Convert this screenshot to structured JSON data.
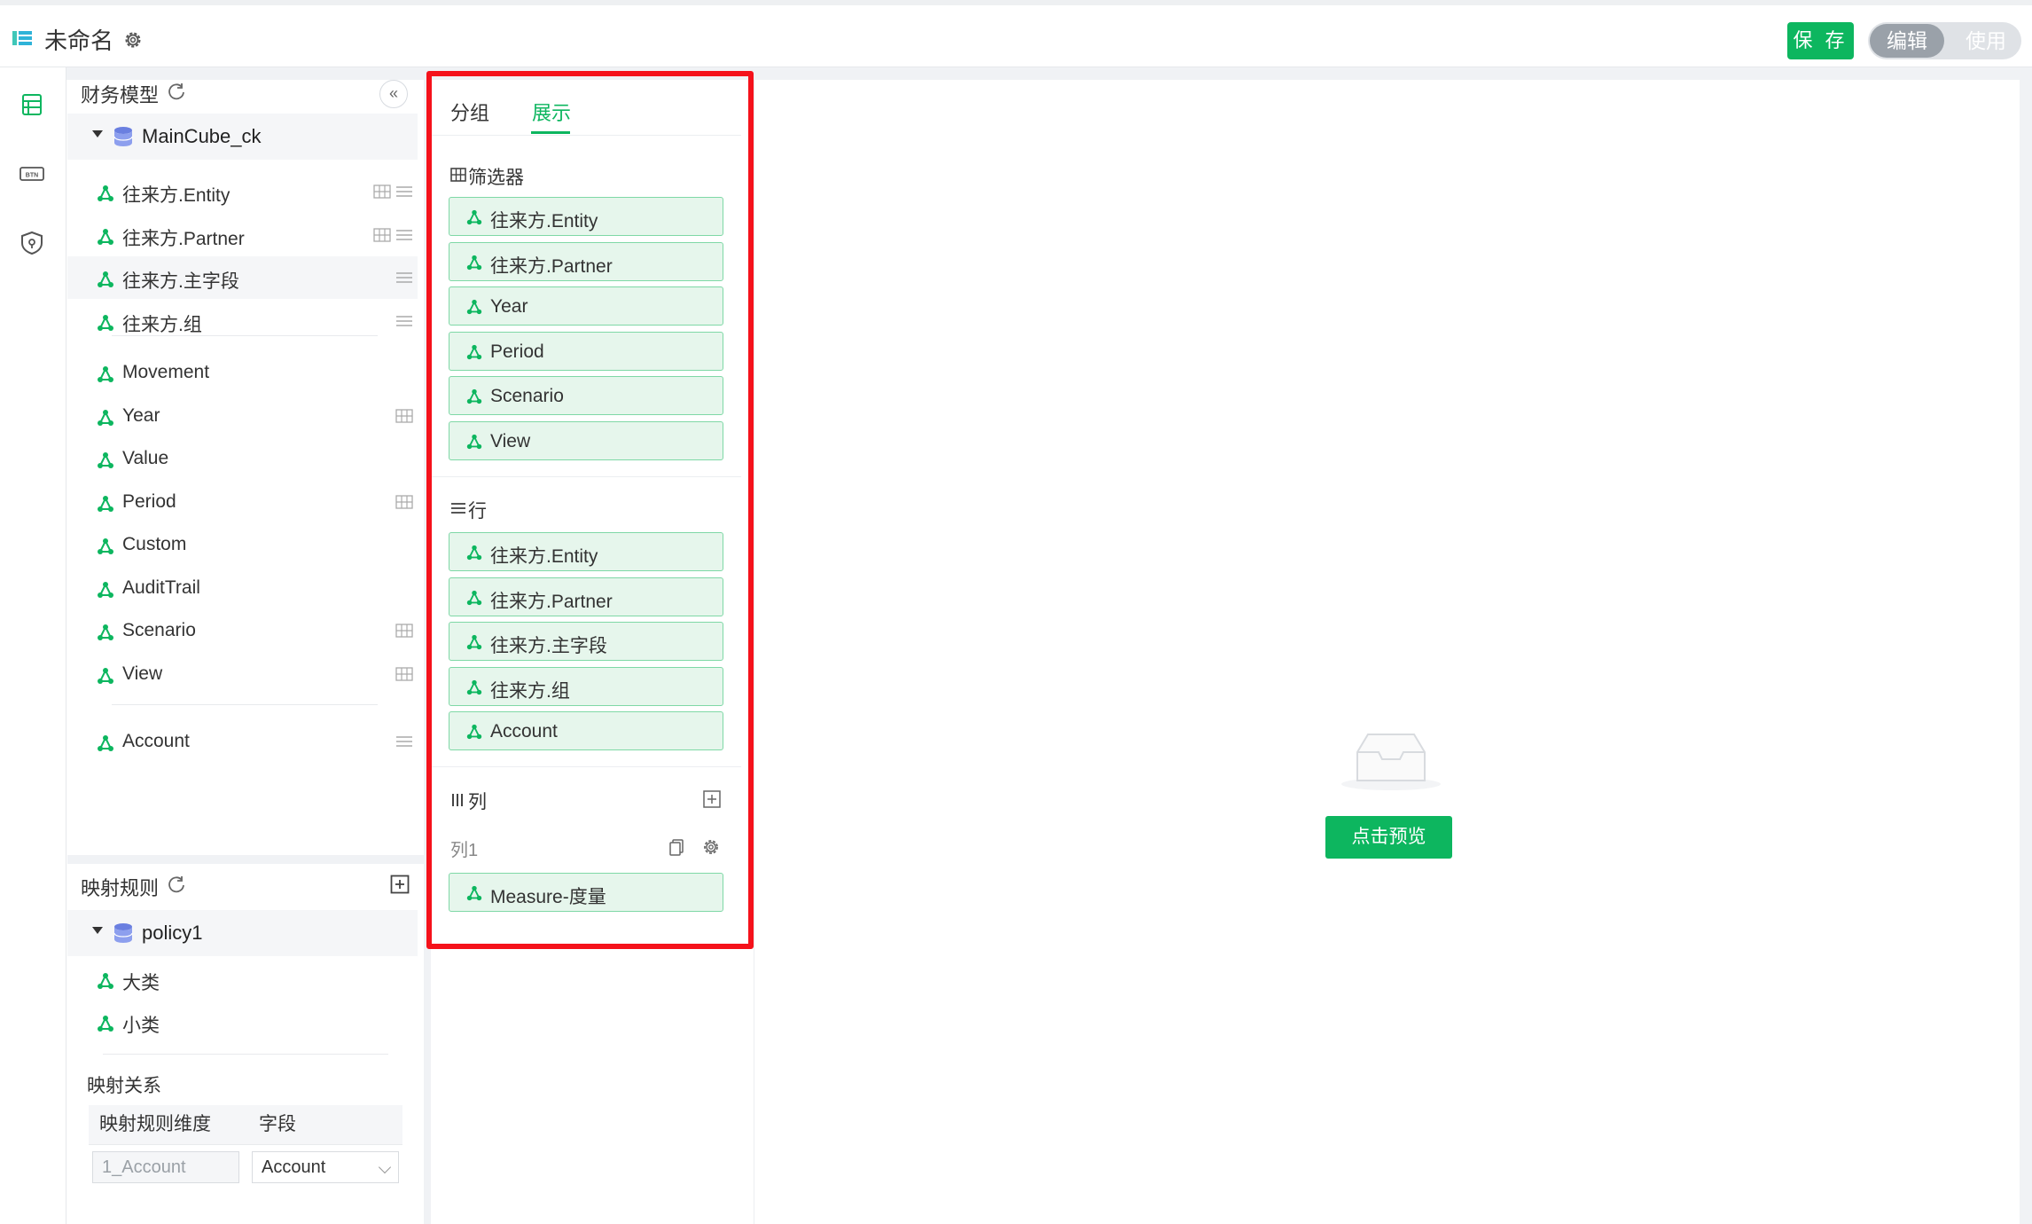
{
  "app": {
    "title": "未命名"
  },
  "header": {
    "save_label": "保 存",
    "mode_edit": "编辑",
    "mode_use": "使用"
  },
  "rail": [
    "table-icon",
    "btn-icon",
    "shield-icon"
  ],
  "model": {
    "title": "财务模型",
    "cube": "MainCube_ck",
    "group1": [
      {
        "label": "往来方.Entity",
        "icons": [
          "grid",
          "list"
        ]
      },
      {
        "label": "往来方.Partner",
        "icons": [
          "grid",
          "list"
        ]
      },
      {
        "label": "往来方.主字段",
        "icons": [
          "list"
        ]
      },
      {
        "label": "往来方.组",
        "icons": [
          "list"
        ]
      }
    ],
    "group2": [
      {
        "label": "Movement",
        "icons": []
      },
      {
        "label": "Year",
        "icons": [
          "grid"
        ]
      },
      {
        "label": "Value",
        "icons": []
      },
      {
        "label": "Period",
        "icons": [
          "grid"
        ]
      },
      {
        "label": "Custom",
        "icons": []
      },
      {
        "label": "AuditTrail",
        "icons": []
      },
      {
        "label": "Scenario",
        "icons": [
          "grid"
        ]
      },
      {
        "label": "View",
        "icons": [
          "grid"
        ]
      }
    ],
    "group3": [
      {
        "label": "Account",
        "icons": [
          "list"
        ]
      }
    ]
  },
  "mapping": {
    "title": "映射规则",
    "policy": "policy1",
    "items": [
      "大类",
      "小类"
    ],
    "relation_title": "映射关系",
    "col_dim": "映射规则维度",
    "col_field": "字段",
    "row_dim": "1_Account",
    "row_field": "Account"
  },
  "config": {
    "tab_group": "分组",
    "tab_display": "展示",
    "filter_title": "筛选器",
    "filters": [
      "往来方.Entity",
      "往来方.Partner",
      "Year",
      "Period",
      "Scenario",
      "View"
    ],
    "rows_title": "行",
    "rows": [
      "往来方.Entity",
      "往来方.Partner",
      "往来方.主字段",
      "往来方.组",
      "Account"
    ],
    "cols_title": "列",
    "col1_label": "列1",
    "cols": [
      "Measure-度量"
    ]
  },
  "preview": {
    "button": "点击预览"
  },
  "colors": {
    "accent": "#0db65f",
    "highlight": "#f5121b"
  }
}
